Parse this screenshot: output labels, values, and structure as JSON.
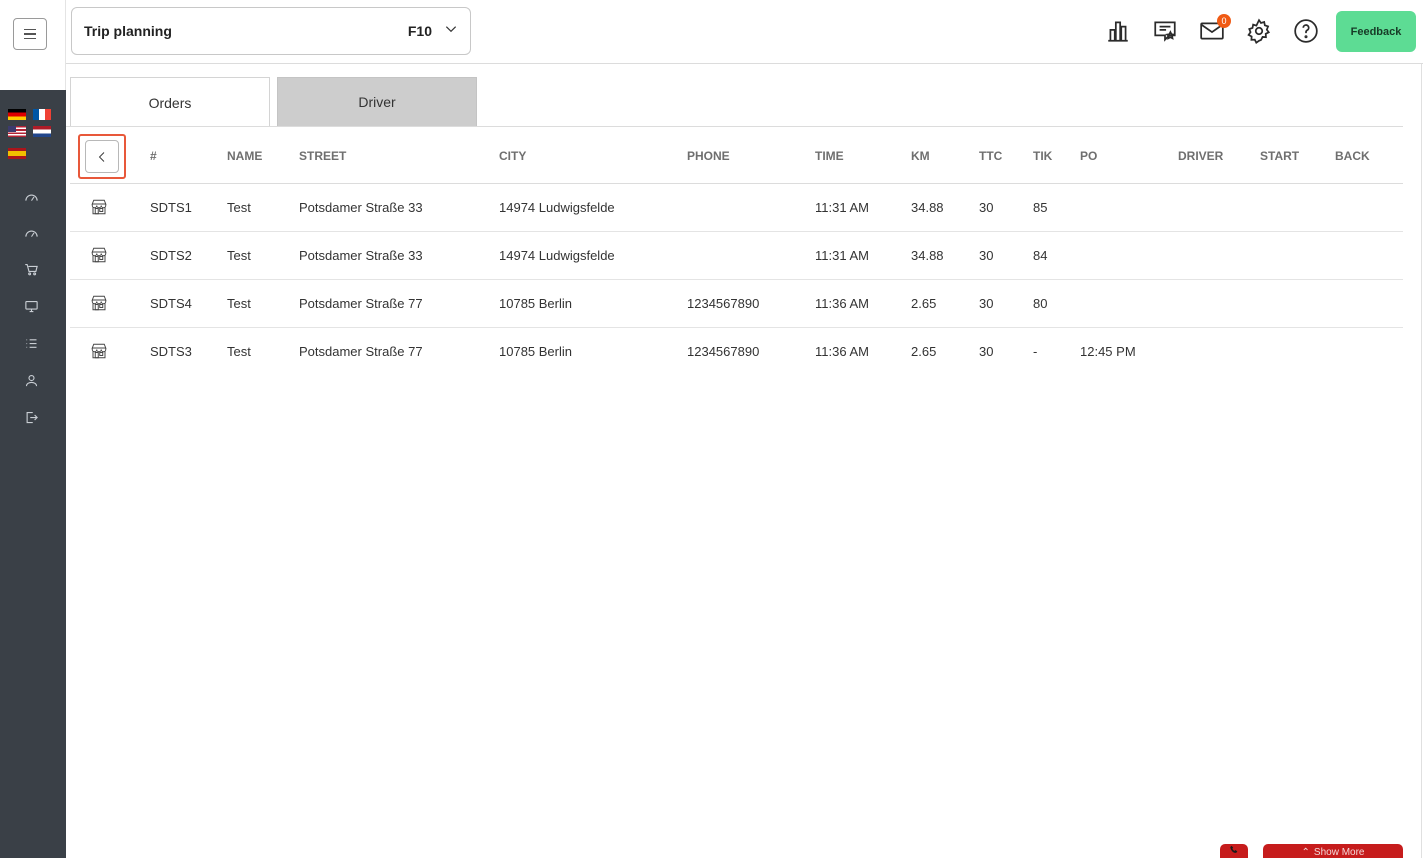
{
  "header": {
    "trip_title": "Trip planning",
    "trip_code": "F10",
    "notification_count": "0",
    "feedback_label": "Feedback"
  },
  "tabs": [
    {
      "label": "Orders"
    },
    {
      "label": "Driver"
    }
  ],
  "table": {
    "columns": [
      "#",
      "NAME",
      "STREET",
      "CITY",
      "PHONE",
      "TIME",
      "KM",
      "TTC",
      "TIK",
      "PO",
      "DRIVER",
      "START",
      "BACK"
    ],
    "rows": [
      {
        "id": "SDTS1",
        "name": "Test",
        "street": "Potsdamer Straße 33",
        "city": "14974 Ludwigsfelde",
        "phone": "",
        "time": "11:31 AM",
        "km": "34.88",
        "ttc": "30",
        "tik": "85",
        "po": "",
        "driver": "",
        "start": "",
        "back": ""
      },
      {
        "id": "SDTS2",
        "name": "Test",
        "street": "Potsdamer Straße 33",
        "city": "14974 Ludwigsfelde",
        "phone": "",
        "time": "11:31 AM",
        "km": "34.88",
        "ttc": "30",
        "tik": "84",
        "po": "",
        "driver": "",
        "start": "",
        "back": ""
      },
      {
        "id": "SDTS4",
        "name": "Test",
        "street": "Potsdamer Straße 77",
        "city": "10785 Berlin",
        "phone": "1234567890",
        "time": "11:36 AM",
        "km": "2.65",
        "ttc": "30",
        "tik": "80",
        "po": "",
        "driver": "",
        "start": "",
        "back": ""
      },
      {
        "id": "SDTS3",
        "name": "Test",
        "street": "Potsdamer Straße 77",
        "city": "10785 Berlin",
        "phone": "1234567890",
        "time": "11:36 AM",
        "km": "2.65",
        "ttc": "30",
        "tik": "-",
        "po": "12:45 PM",
        "driver": "",
        "start": "",
        "back": ""
      }
    ]
  },
  "footer": {
    "show_more_label": "Show More"
  },
  "icons": {
    "menu": "hamburger-icon",
    "chart": "bar-chart-icon",
    "reviews": "chat-star-icon",
    "mail": "mail-icon",
    "settings": "gear-icon",
    "help": "help-icon",
    "back": "chevron-left-icon",
    "row": "store-icon"
  },
  "colors": {
    "sidebar": "#3a4047",
    "feedback": "#5ddc94",
    "badge": "#f05a14",
    "highlight": "#e8583a",
    "bottom_button": "#c61c1c"
  }
}
